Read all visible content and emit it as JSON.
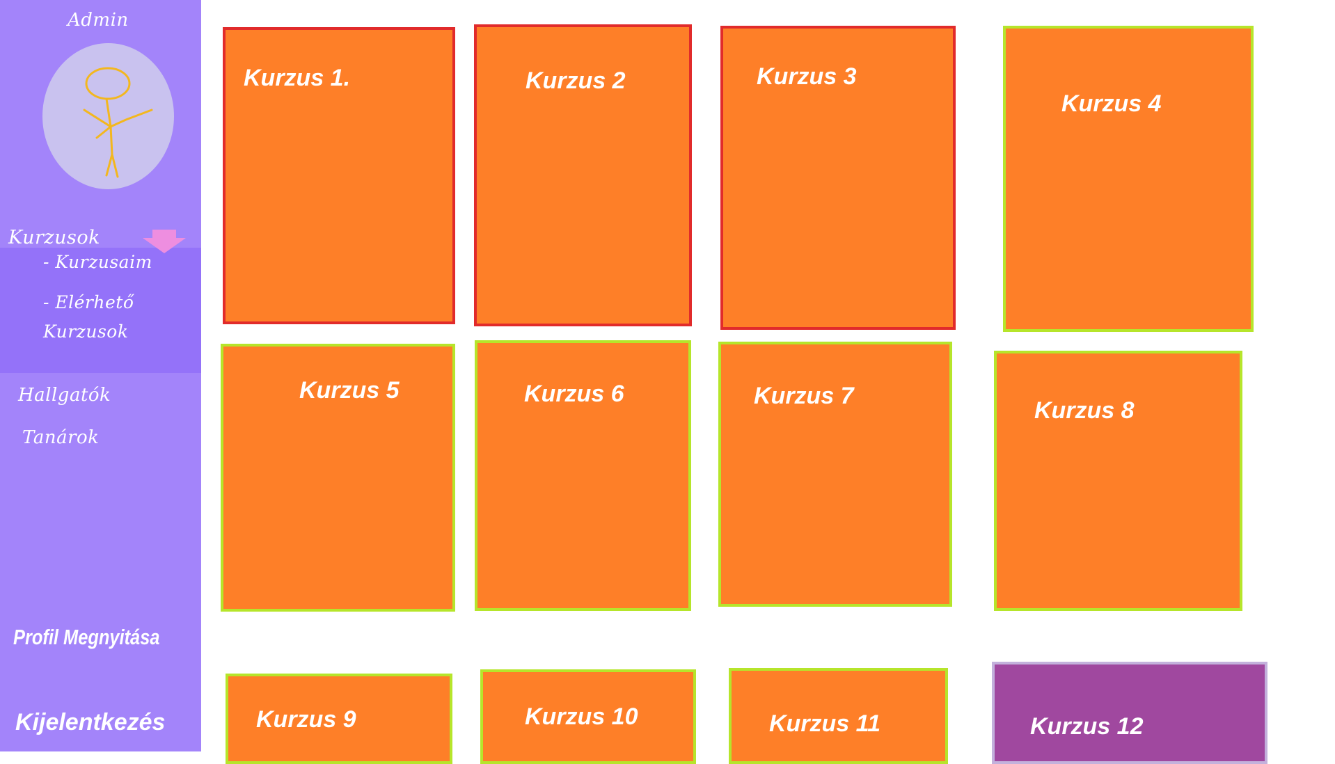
{
  "sidebar": {
    "admin_label": "Admin",
    "avatar_icon": "stick-figure-icon",
    "menu": {
      "kurzusok_label": "Kurzusok",
      "expand_icon": "arrow-down-icon",
      "sub_items": [
        "- Kurzusaim",
        "- Elérhető Kurzusok"
      ],
      "hallgatok_label": "Hallgatók",
      "tanarok_label": "Tanárok"
    },
    "profile_link": "Profil Megnyitása",
    "logout_link": "Kijelentkezés"
  },
  "courses": [
    {
      "title": "Kurzus 1.",
      "enrolled": true
    },
    {
      "title": "Kurzus 2",
      "enrolled": true
    },
    {
      "title": "Kurzus 3",
      "enrolled": true
    },
    {
      "title": "Kurzus 4",
      "enrolled": false
    },
    {
      "title": "Kurzus 5",
      "enrolled": false
    },
    {
      "title": "Kurzus 6",
      "enrolled": false
    },
    {
      "title": "Kurzus 7",
      "enrolled": false
    },
    {
      "title": "Kurzus 8",
      "enrolled": false
    },
    {
      "title": "Kurzus 9",
      "enrolled": false
    },
    {
      "title": "Kurzus 10",
      "enrolled": false
    },
    {
      "title": "Kurzus 11",
      "enrolled": false
    },
    {
      "title": "Kurzus 12",
      "enrolled": false,
      "highlighted": true
    }
  ],
  "colors": {
    "sidebar": "#a384fa",
    "submenu": "#9472f9",
    "card": "#fe7f28",
    "card_enrolled_border": "#e12b2b",
    "card_border": "#b6e52b",
    "card_highlighted": "#a0489f"
  }
}
